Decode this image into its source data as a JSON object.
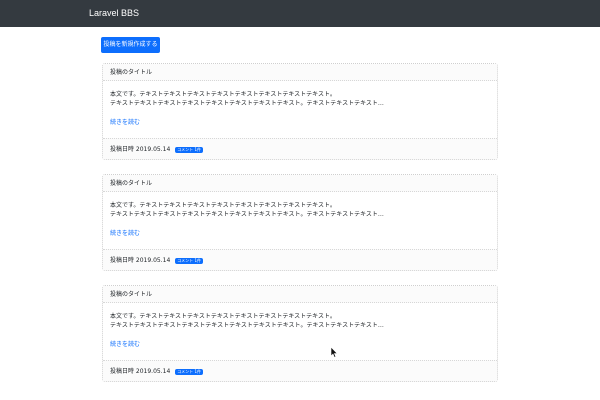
{
  "navbar": {
    "brand": "Laravel BBS"
  },
  "toolbar": {
    "new_post_label": "投稿を新規作成する"
  },
  "posts": [
    {
      "title": "投稿のタイトル",
      "body_line1": "本文です。テキストテキストテキストテキストテキストテキストテキストテキスト。",
      "body_line2": "テキストテキストテキストテキストテキストテキストテキストテキスト。テキストテキストテキスト…",
      "read_more": "続きを読む",
      "date_text": "投稿日時 2019.05.14",
      "comment_badge": "コメント 1件"
    },
    {
      "title": "投稿のタイトル",
      "body_line1": "本文です。テキストテキストテキストテキストテキストテキストテキストテキスト。",
      "body_line2": "テキストテキストテキストテキストテキストテキストテキストテキスト。テキストテキストテキスト…",
      "read_more": "続きを読む",
      "date_text": "投稿日時 2019.05.14",
      "comment_badge": "コメント 1件"
    },
    {
      "title": "投稿のタイトル",
      "body_line1": "本文です。テキストテキストテキストテキストテキストテキストテキストテキスト。",
      "body_line2": "テキストテキストテキストテキストテキストテキストテキストテキスト。テキストテキストテキスト…",
      "read_more": "続きを読む",
      "date_text": "投稿日時 2019.05.14",
      "comment_badge": "コメント 1件"
    }
  ],
  "colors": {
    "navbar": "#343a40",
    "primary": "#0d6efd",
    "card_border": "#cfcfcf",
    "text": "#212529"
  },
  "icons": {
    "cursor": "mouse-pointer-icon"
  }
}
